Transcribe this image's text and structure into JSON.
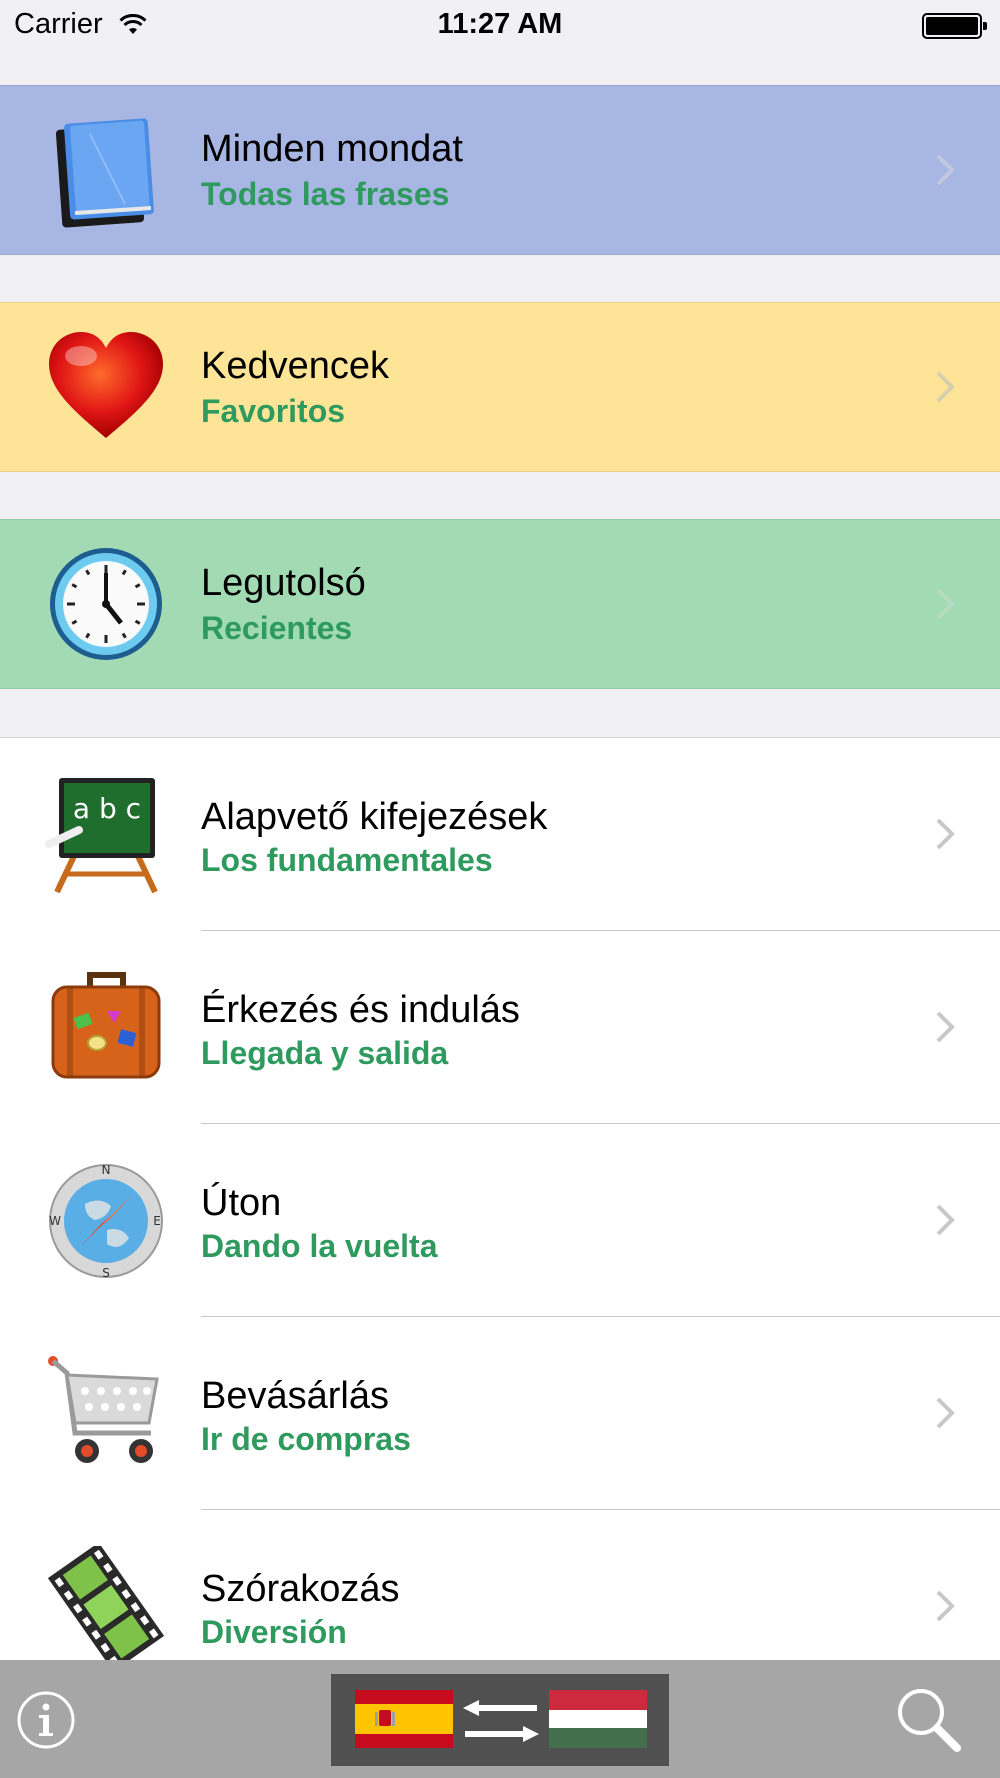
{
  "status_bar": {
    "carrier": "Carrier",
    "time": "11:27 AM"
  },
  "colors": {
    "all_sentences_bg": "#a8b6e3",
    "favorites_bg": "#fee497",
    "recent_bg": "#a2dbb3",
    "subtitle_green": "#2e9a5e",
    "bottom_bar": "#a6a6a6"
  },
  "top_rows": [
    {
      "title": "Minden mondat",
      "subtitle": "Todas las frases",
      "icon": "book-icon"
    },
    {
      "title": "Kedvencek",
      "subtitle": "Favoritos",
      "icon": "heart-icon"
    },
    {
      "title": "Legutolsó",
      "subtitle": "Recientes",
      "icon": "clock-icon"
    }
  ],
  "categories": [
    {
      "title": "Alapvető kifejezések",
      "subtitle": "Los fundamentales",
      "icon": "chalkboard-icon"
    },
    {
      "title": "Érkezés és indulás",
      "subtitle": "Llegada y salida",
      "icon": "suitcase-icon"
    },
    {
      "title": "Úton",
      "subtitle": "Dando la vuelta",
      "icon": "compass-icon"
    },
    {
      "title": "Bevásárlás",
      "subtitle": "Ir de compras",
      "icon": "shopping-cart-icon"
    },
    {
      "title": "Szórakozás",
      "subtitle": "Diversión",
      "icon": "film-icon"
    }
  ],
  "bottom_bar": {
    "info_icon": "info-icon",
    "language_switch": {
      "from_flag": "spain-flag-icon",
      "arrows": "swap-arrows-icon",
      "to_flag": "hungary-flag-icon"
    },
    "search_icon": "search-icon"
  }
}
